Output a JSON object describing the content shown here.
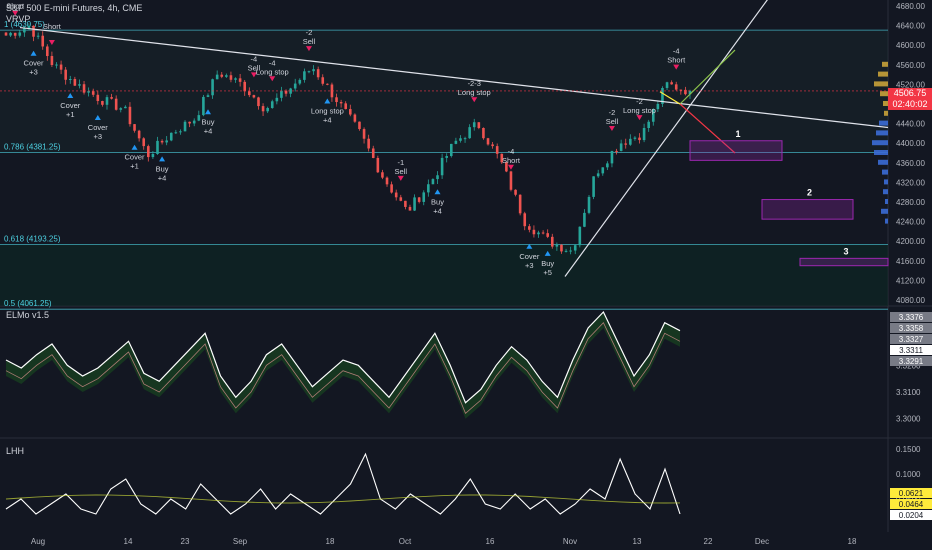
{
  "header": {
    "symbol": "S&P 500 E-mini Futures, 4h, CME",
    "indicator": "VRVP"
  },
  "price_panel": {
    "current_price": "4506.75",
    "countdown": "02:40:02",
    "fib_levels": [
      {
        "label": "1 (4630.75)",
        "value": 4630.75
      },
      {
        "label": "0.786 (4381.25)",
        "value": 4381.25
      },
      {
        "label": "0.618 (4193.25)",
        "value": 4193.25
      },
      {
        "label": "0.5 (4061.25)",
        "value": 4061.25
      }
    ],
    "scenario_labels": [
      "1",
      "2",
      "3"
    ]
  },
  "elmo_panel": {
    "title": "ELMo v1.5",
    "axis_ticks": [
      "3.3200",
      "3.3100",
      "3.3000"
    ],
    "badges": [
      {
        "text": "3.3376",
        "style": "gray"
      },
      {
        "text": "3.3358",
        "style": "gray"
      },
      {
        "text": "3.3327",
        "style": "gray"
      },
      {
        "text": "3.3311",
        "style": "white"
      },
      {
        "text": "3.3291",
        "style": "gray"
      }
    ]
  },
  "lhh_panel": {
    "title": "LHH",
    "axis_ticks": [
      "0.1500",
      "0.1000",
      "0.0500"
    ],
    "badges": [
      {
        "text": "0.0621",
        "style": "yellow"
      },
      {
        "text": "0.0464",
        "style": "yellow"
      },
      {
        "text": "0.0204",
        "style": "white"
      }
    ]
  },
  "time_axis": [
    "Aug",
    "14",
    "23",
    "Sep",
    "18",
    "Oct",
    "16",
    "Nov",
    "13",
    "22",
    "Dec",
    "18"
  ],
  "colors": {
    "background": "#131722",
    "up_candle": "#26a69a",
    "down_candle": "#ef5350",
    "buy_signal": "#2196f3",
    "sell_signal": "#e91e63",
    "fib_line": "#4dd0e1",
    "trend_line": "#e0e3eb",
    "scenario_box": "#9c27b0",
    "lhh_line": "#ffffff"
  },
  "chart_data": [
    {
      "type": "candlestick",
      "title": "S&P 500 E-mini Futures, 4h, CME",
      "ylim": [
        4080,
        4680
      ],
      "y_ticks": [
        4680,
        4640,
        4600,
        4560,
        4520,
        4480,
        4440,
        4400,
        4360,
        4320,
        4280,
        4240,
        4200,
        4160,
        4120,
        4080
      ],
      "x_ticks": [
        "Aug",
        "14",
        "23",
        "Sep",
        "18",
        "Oct",
        "16",
        "Nov",
        "13",
        "22",
        "Dec",
        "18"
      ],
      "price_path": [
        {
          "date": "Jul 27",
          "price": 4620
        },
        {
          "date": "Jul 31",
          "price": 4640
        },
        {
          "date": "Aug 3",
          "price": 4560
        },
        {
          "date": "Aug 8",
          "price": 4520
        },
        {
          "date": "Aug 11",
          "price": 4490
        },
        {
          "date": "Aug 14",
          "price": 4470
        },
        {
          "date": "Aug 18",
          "price": 4375
        },
        {
          "date": "Aug 22",
          "price": 4420
        },
        {
          "date": "Aug 25",
          "price": 4450
        },
        {
          "date": "Aug 30",
          "price": 4545
        },
        {
          "date": "Sep 5",
          "price": 4520
        },
        {
          "date": "Sep 8",
          "price": 4470
        },
        {
          "date": "Sep 12",
          "price": 4510
        },
        {
          "date": "Sep 15",
          "price": 4555
        },
        {
          "date": "Sep 19",
          "price": 4490
        },
        {
          "date": "Sep 22",
          "price": 4420
        },
        {
          "date": "Sep 27",
          "price": 4330
        },
        {
          "date": "Oct 3",
          "price": 4260
        },
        {
          "date": "Oct 6",
          "price": 4320
        },
        {
          "date": "Oct 12",
          "price": 4400
        },
        {
          "date": "Oct 16",
          "price": 4440
        },
        {
          "date": "Oct 20",
          "price": 4360
        },
        {
          "date": "Oct 24",
          "price": 4240
        },
        {
          "date": "Oct 27",
          "price": 4200
        },
        {
          "date": "Nov 1",
          "price": 4180
        },
        {
          "date": "Nov 6",
          "price": 4340
        },
        {
          "date": "Nov 9",
          "price": 4400
        },
        {
          "date": "Nov 14",
          "price": 4420
        },
        {
          "date": "Nov 16",
          "price": 4520
        },
        {
          "date": "Nov 17",
          "price": 4506.75
        }
      ],
      "signals": [
        {
          "text": "-4 Short",
          "type": "sell"
        },
        {
          "text": "Short",
          "type": "sell"
        },
        {
          "text": "Cover +3",
          "type": "buy"
        },
        {
          "text": "Cover +1",
          "type": "buy"
        },
        {
          "text": "Cover +3",
          "type": "buy"
        },
        {
          "text": "Cover +1",
          "type": "buy"
        },
        {
          "text": "Buy +4",
          "type": "buy"
        },
        {
          "text": "Buy +4",
          "type": "buy"
        },
        {
          "text": "-4 Sell",
          "type": "sell"
        },
        {
          "text": "-4 Long stop",
          "type": "sell"
        },
        {
          "text": "-2 Sell",
          "type": "sell"
        },
        {
          "text": "Long stop +4",
          "type": "buy"
        },
        {
          "text": "-1 Sell",
          "type": "sell"
        },
        {
          "text": "Buy +4",
          "type": "buy"
        },
        {
          "text": "-2-3 Long stop",
          "type": "sell"
        },
        {
          "text": "-4 Short",
          "type": "sell"
        },
        {
          "text": "Cover +3",
          "type": "buy"
        },
        {
          "text": "Buy +5",
          "type": "buy"
        },
        {
          "text": "-2 Sell",
          "type": "sell"
        },
        {
          "text": "-2 Long stop",
          "type": "sell"
        },
        {
          "text": "-4 Short",
          "type": "sell"
        }
      ],
      "scenario_boxes": [
        {
          "label": "1",
          "low": 4365,
          "high": 4405
        },
        {
          "label": "2",
          "low": 4245,
          "high": 4285
        },
        {
          "label": "3",
          "low": 4150,
          "high": 4165
        }
      ]
    },
    {
      "type": "line",
      "title": "ELMo v1.5",
      "ylim": [
        3.295,
        3.34
      ],
      "series": [
        {
          "values": [
            3.32,
            3.317,
            3.322,
            3.326,
            3.318,
            3.314,
            3.317,
            3.322,
            3.327,
            3.315,
            3.312,
            3.318,
            3.324,
            3.33,
            3.314,
            3.306,
            3.312,
            3.322,
            3.326,
            3.318,
            3.31,
            3.315,
            3.32,
            3.318,
            3.312,
            3.306,
            3.314,
            3.322,
            3.33,
            3.318,
            3.304,
            3.309,
            3.318,
            3.325,
            3.32,
            3.312,
            3.306,
            3.32,
            3.332,
            3.338,
            3.326,
            3.314,
            3.322,
            3.334,
            3.331
          ]
        }
      ]
    },
    {
      "type": "line",
      "title": "LHH",
      "ylim": [
        0.0,
        0.16
      ],
      "series": [
        {
          "values": [
            0.03,
            0.05,
            0.02,
            0.04,
            0.06,
            0.03,
            0.02,
            0.07,
            0.09,
            0.04,
            0.02,
            0.05,
            0.03,
            0.08,
            0.05,
            0.02,
            0.04,
            0.07,
            0.03,
            0.06,
            0.04,
            0.02,
            0.05,
            0.08,
            0.14,
            0.05,
            0.03,
            0.06,
            0.04,
            0.02,
            0.05,
            0.09,
            0.04,
            0.03,
            0.06,
            0.03,
            0.05,
            0.02,
            0.04,
            0.07,
            0.05,
            0.13,
            0.06,
            0.03,
            0.11,
            0.02
          ]
        }
      ]
    }
  ]
}
